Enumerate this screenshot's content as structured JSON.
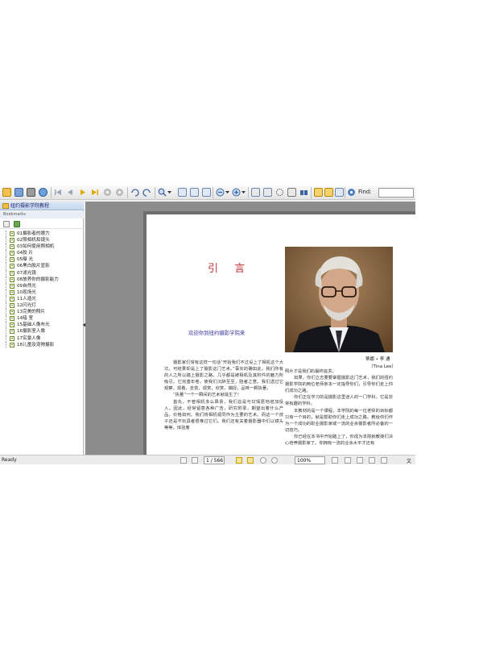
{
  "app": {
    "active_document_tab": "纽约摄影学院教程",
    "panel_title": "Bookmarks"
  },
  "toolbar": {
    "find_label": "Find:",
    "find_value": ""
  },
  "bookmarks": [
    "01摄影者的眼力",
    "02照相机和镜头",
    "03如何使用照相机",
    "04胶 片",
    "05曝 光",
    "06黑白胶片显影",
    "07滤光镜",
    "08放养你的摄影能力",
    "09自然光",
    "10现场光",
    "11人造光",
    "12闪光灯",
    "13完美的照片",
    "14暗 室",
    "15基础人像布光",
    "16摄影室人像",
    "17实景人像",
    "18儿童及宠物摄影"
  ],
  "page": {
    "chapter_title": "引 言",
    "subtitle": "欢迎你到纽约摄影学院来",
    "caption_name": "蒂娜 • 李 通",
    "caption_en": "（Tina Lee）",
    "left_paragraphs": [
      "摄影家们常有这样一句话“开始我们不过设上了相机这个大坑，可结果却是上了摄影这门艺术。”事实的确如此，我们所有的人之所以踏上摄影之路，几乎都是被相机及其附件的魅力所吸引。它完善年卷，使我们沉醉至至，陷者之意。我们透过它观察，观看，去尝，观赏，欣赏，捕捉，品味一颗执著，",
      "“执著”一个一瞬间的艺术就诞生了！",
      "首先，不管相机多么昂贵，我们总是与甘情愿地增加投入。因此，经常留意各种广告，研究附录，期望出着什么产品，价格如何。我们将相机视同作为主要的艺术。而这一个孩子还是不玩具者很难过它们。我们还有关着摄影器中们以镜头等等。体验着"
    ],
    "right_paragraphs": [
      "照片才是我们的最终追求。",
      "如果，你们立志要要掌握摄影这门艺术，我们的纽约摄影学院的两位老师亲本一定指导你们，引导你们走上你们成功之路。",
      "你们正在学习的是摄影这里迷人的一门学科，它是非常有趣的学科。",
      "本教材的是一个课程，本学院的每一位老师的目标都只有一个目的，就是帮助你们走上成功之路。教给你们作为一个成功的职业摄影家或一流的业余摄影者所必备的一切技巧。",
      "你已经在本书中开始踏上了，你成为本院就教授们决心培养摄影家了。你拥有一流的业余水平才还有"
    ]
  },
  "statusbar": {
    "status": "Ready",
    "page_indicator": "1 / 566",
    "zoom": "100%",
    "right_label": "文件"
  }
}
